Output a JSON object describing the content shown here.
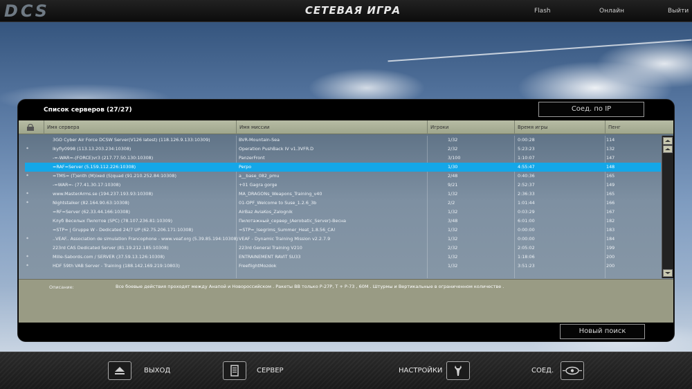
{
  "header": {
    "logo": "DCS",
    "title": "СЕТЕВАЯ ИГРА",
    "links": [
      "Flash",
      "Онлайн",
      "Выйти"
    ]
  },
  "panel": {
    "title": "Список серверов (27/27)",
    "connect_ip_label": "Соед. по IP",
    "new_search_label": "Новый поиск"
  },
  "table": {
    "columns": [
      "Имя сервера",
      "Имя миссии",
      "Игроки",
      "Время игры",
      "Пенг"
    ],
    "selected_index": 3,
    "rows": [
      {
        "mark": "",
        "name": "3GO Cyber Air Force DCSW Server(V126 latest) (118.126.9.133:10309)",
        "mission": "BVR-Mountain-Sea",
        "players": "1/32",
        "time": "0:00:28",
        "ping": "114"
      },
      {
        "mark": "*",
        "name": "lkyfly0998 (113.13.203.234:10308)",
        "mission": "Operation PushBack IV v1.3VFR.D",
        "players": "2/32",
        "time": "5:23:23",
        "ping": "132"
      },
      {
        "mark": "",
        "name": "-=-WAR=-(FORCE)vr3 (217.77.50.130:10308)",
        "mission": "PanzerFront",
        "players": "3/100",
        "time": "1:10:07",
        "ping": "147"
      },
      {
        "mark": "",
        "name": "=RAF=Server (5.159.112.226:10308)",
        "mission": "Perpo",
        "players": "1/30",
        "time": "4:55:47",
        "ping": "148"
      },
      {
        "mark": "*",
        "name": "=TMS= (T)enth (M)ixed (S)quad (91.210.252.84:10308)",
        "mission": "a__base_082_pmu",
        "players": "2/48",
        "time": "0:40:36",
        "ping": "165"
      },
      {
        "mark": "",
        "name": "-=WAR=- (77.41.30.17:10308)",
        "mission": "+01 Gagra gorge",
        "players": "9/21",
        "time": "2:52:37",
        "ping": "149"
      },
      {
        "mark": "*",
        "name": "www.MasterArms.se (194.237.193.93:10308)",
        "mission": "MA_DRAGONs_Weapons_Training_v40",
        "players": "1/32",
        "time": "2:36:33",
        "ping": "165"
      },
      {
        "mark": "*",
        "name": "Nightstalker (82.164.90.63:10308)",
        "mission": "01-OPF_Welcome to Suse_1.2.6_3b",
        "players": "2/2",
        "time": "1:01:44",
        "ping": "166"
      },
      {
        "mark": "",
        "name": "=RF=Server (62.33.44.166:10308)",
        "mission": "AirBaz AviaKos_Zalognik",
        "players": "1/32",
        "time": "0:03:29",
        "ping": "167"
      },
      {
        "mark": "",
        "name": "Клуб Веселых Пилотов (SPC) (78.107.236.81:10309)",
        "mission": "Пилотажный_сервер_(Aerobatic_Server)-Весна",
        "players": "3/48",
        "time": "6:01:00",
        "ping": "182"
      },
      {
        "mark": "",
        "name": "=STP= | Gruppe W -  Dedicated 24/7 UP (62.75.206.171:10308)",
        "mission": "=STP=_Isegrims_Summer_Heat_1.8.56_CA!",
        "players": "1/32",
        "time": "0:00:00",
        "ping": "183"
      },
      {
        "mark": "*",
        "name": "..VEAF.. Association de simulation Francophone - www.veaf.org (5.39.85.194:10308)",
        "mission": "VEAF - Dynamic Training Mission v2.2.7.9",
        "players": "1/32",
        "time": "0:00:00",
        "ping": "184"
      },
      {
        "mark": "",
        "name": "223rd CAS Dedicated Server (81.19.212.185:10308)",
        "mission": "223rd General Training V210",
        "players": "2/32",
        "time": "2:05:02",
        "ping": "199"
      },
      {
        "mark": "*",
        "name": "Mille-Sabords.com / SERVER (37.59.13.126:10308)",
        "mission": "ENTRAINEMENT RAVIT SU33",
        "players": "1/32",
        "time": "1:18:06",
        "ping": "200"
      },
      {
        "mark": "*",
        "name": "HDF 59th VAB Server - Training (188.142.169.219:10803)",
        "mission": "FreeflightMozdok",
        "players": "1/32",
        "time": "3:51:23",
        "ping": "200"
      }
    ]
  },
  "description": {
    "label": "Описание:",
    "text": "Все боевые действия проходят между Анапой и Новороссийском . Ракеты ВВ только Р-27Р, Т + Р-73 , 60М . Штурмы и Вертикальные  в  ограниченном  количестве ."
  },
  "footer": {
    "exit_label": "ВЫХОД",
    "server_label": "СЕРВЕР",
    "settings_label": "НАСТРОЙКИ",
    "connect_label": "СОЕД."
  },
  "colors": {
    "selected_row": "#14a7e8",
    "header_bar": "#b7bca4",
    "description_bg": "#999b84"
  }
}
